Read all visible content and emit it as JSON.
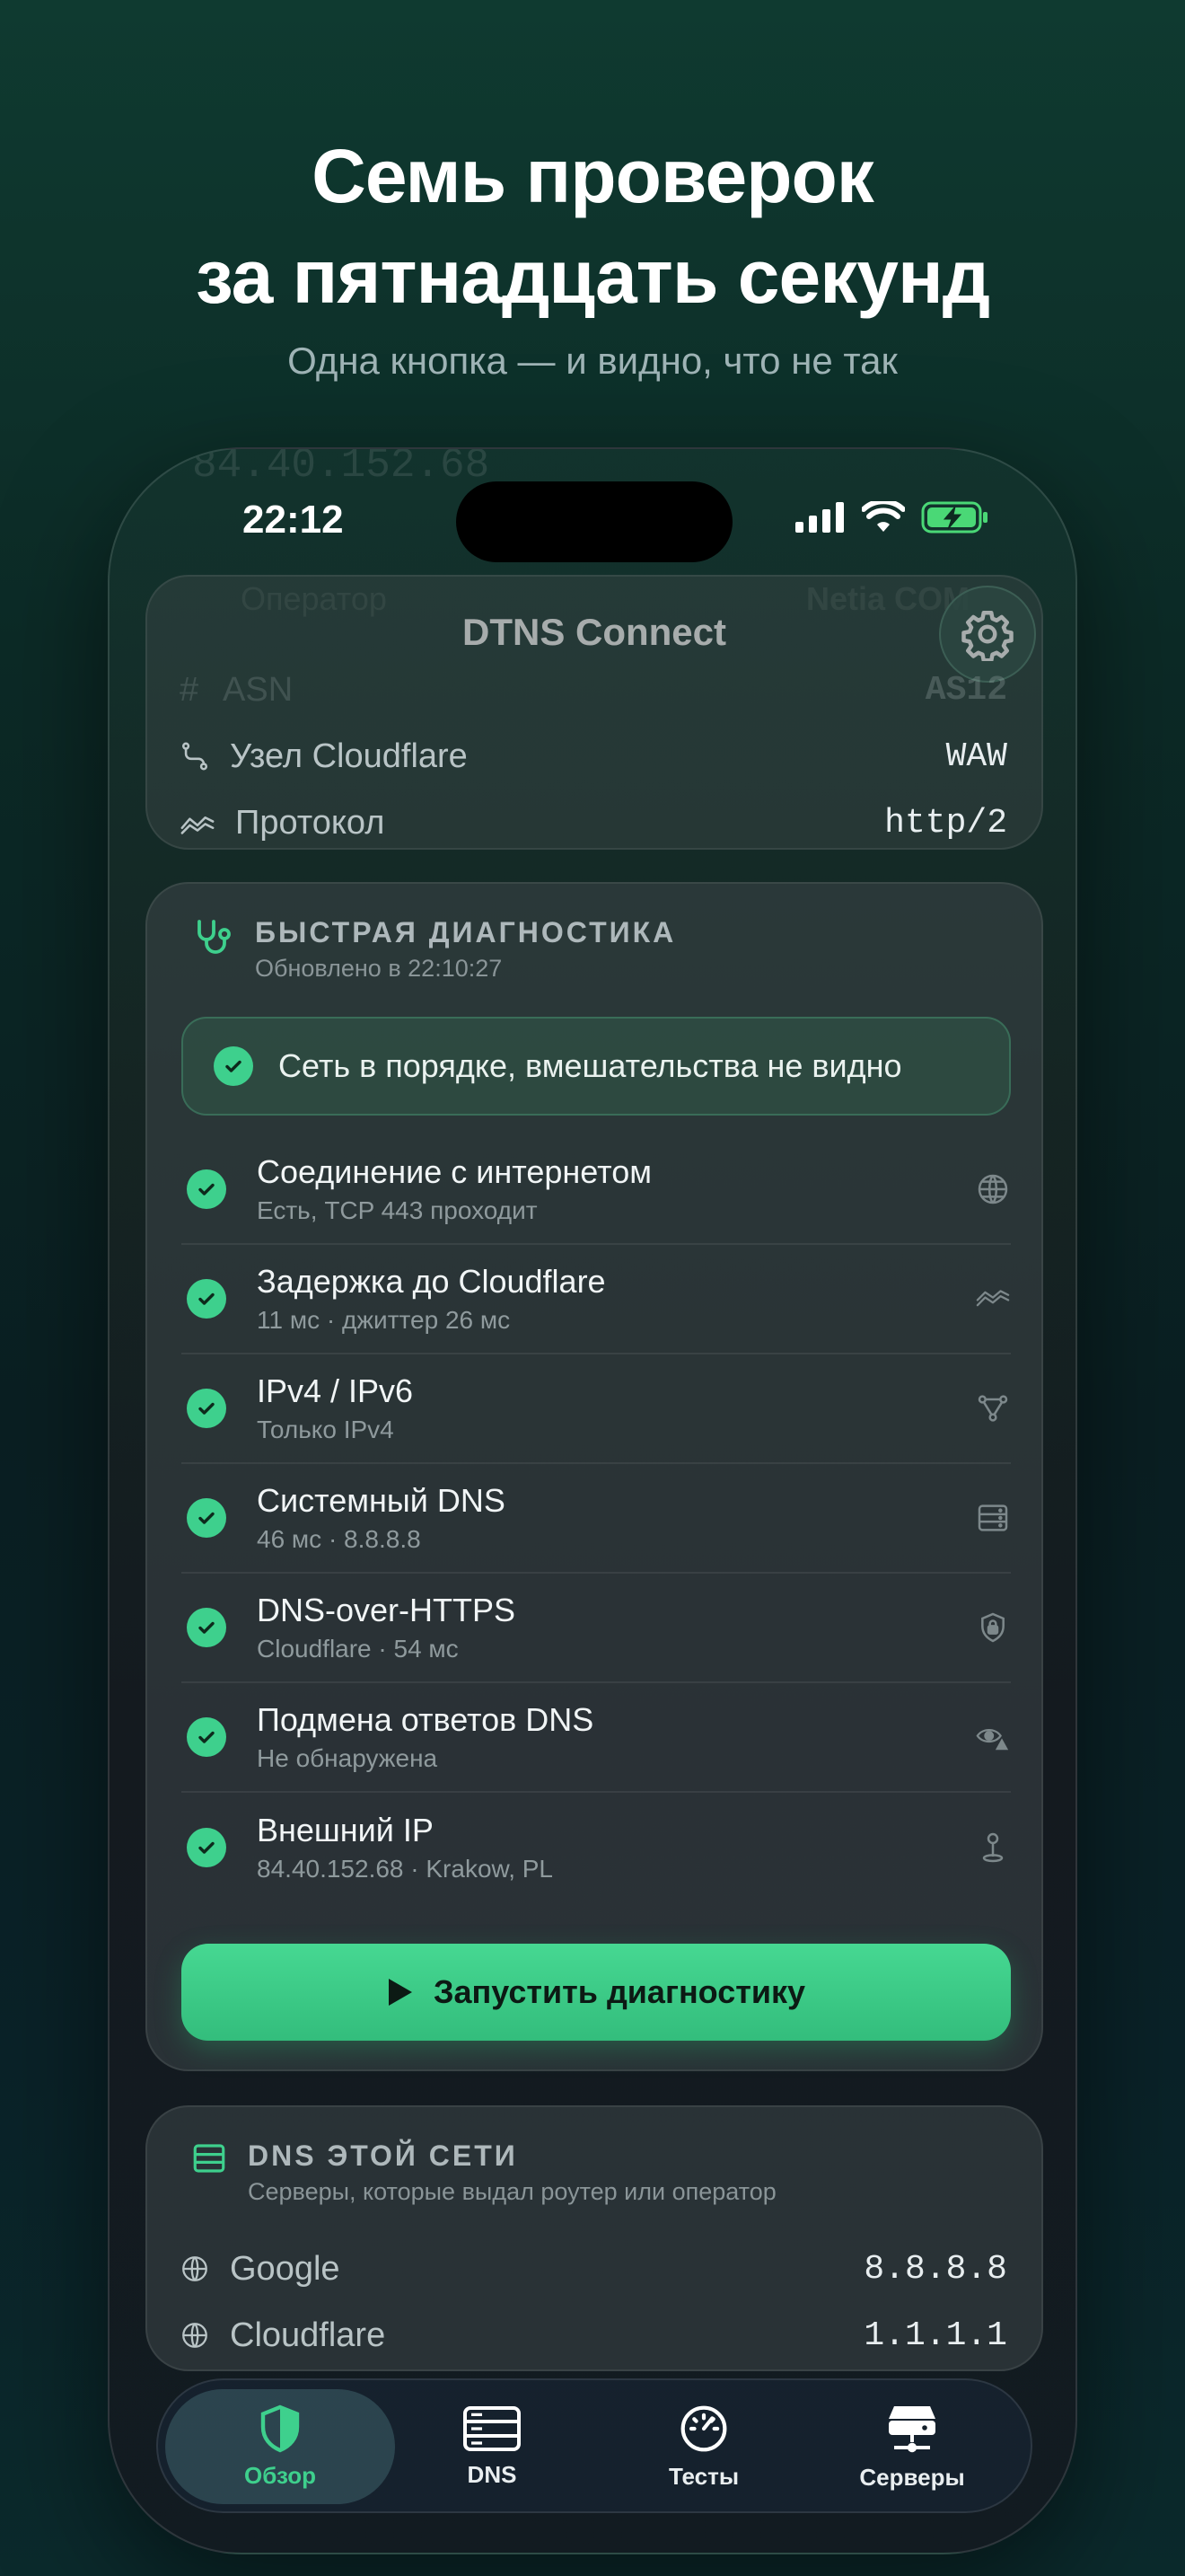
{
  "hero": {
    "title_line1": "Семь проверок",
    "title_line2": "за пятнадцать секунд",
    "subtitle": "Одна кнопка — и видно, что не так"
  },
  "status_bar": {
    "time": "22:12"
  },
  "app": {
    "title": "DTNS Connect"
  },
  "background_ghost": {
    "ip": "84.40.152.68",
    "operator_label": "Оператор",
    "operator_value": "Netia COM"
  },
  "connection_card": {
    "rows": [
      {
        "icon": "hash-icon",
        "label": "ASN",
        "value": "AS12"
      },
      {
        "icon": "route-icon",
        "label": "Узел Cloudflare",
        "value": "WAW"
      },
      {
        "icon": "wave-icon",
        "label": "Протокол",
        "value": "http/2"
      }
    ]
  },
  "diagnostics": {
    "title": "БЫСТРАЯ ДИАГНОСТИКА",
    "updated": "Обновлено в 22:10:27",
    "banner": "Сеть в порядке, вмешательства не видно",
    "items": [
      {
        "title": "Соединение с интернетом",
        "subtitle": "Есть, TCP 443 проходит",
        "icon": "globe-icon"
      },
      {
        "title": "Задержка до Cloudflare",
        "subtitle": "11 мс · джиттер 26 мс",
        "icon": "wave-icon"
      },
      {
        "title": "IPv4 / IPv6",
        "subtitle": "Только IPv4",
        "icon": "network-nodes-icon"
      },
      {
        "title": "Системный DNS",
        "subtitle": "46 мс · 8.8.8.8",
        "icon": "server-icon"
      },
      {
        "title": "DNS-over-HTTPS",
        "subtitle": "Cloudflare · 54 мс",
        "icon": "lock-shield-icon"
      },
      {
        "title": "Подмена ответов DNS",
        "subtitle": "Не обнаружена",
        "icon": "eye-warning-icon"
      },
      {
        "title": "Внешний IP",
        "subtitle": "84.40.152.68 · Krakow, PL",
        "icon": "location-pin-icon"
      }
    ],
    "run_button": "Запустить диагностику"
  },
  "network_dns": {
    "title": "DNS ЭТОЙ СЕТИ",
    "subtitle": "Серверы, которые выдал роутер или оператор",
    "rows": [
      {
        "label": "Google",
        "value": "8.8.8.8"
      },
      {
        "label": "Cloudflare",
        "value": "1.1.1.1"
      }
    ]
  },
  "tabs": [
    {
      "label": "Обзор",
      "icon": "shield-icon",
      "active": true
    },
    {
      "label": "DNS",
      "icon": "server-icon",
      "active": false
    },
    {
      "label": "Тесты",
      "icon": "speedometer-icon",
      "active": false
    },
    {
      "label": "Серверы",
      "icon": "servers-stack-icon",
      "active": false
    }
  ],
  "colors": {
    "accent": "#3ed08d",
    "background": "#0c2a26"
  }
}
